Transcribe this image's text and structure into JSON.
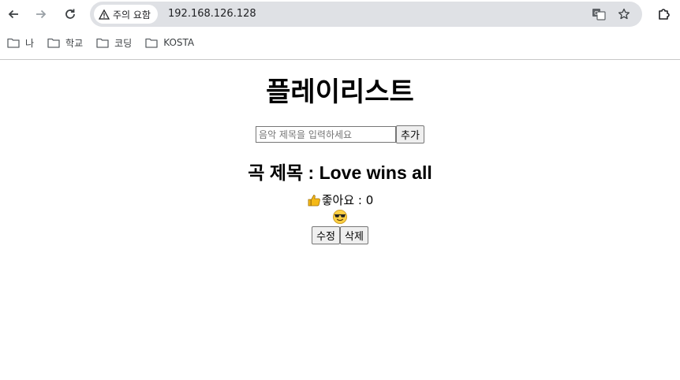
{
  "browser": {
    "security_label": "주의 요함",
    "url": "192.168.126.128",
    "icons": [
      "back-icon",
      "forward-icon",
      "reload-icon",
      "warning-icon",
      "translate-icon",
      "star-icon",
      "extensions-icon",
      "folder-icon",
      "thumbs-up-icon",
      "sunglasses-face-icon"
    ]
  },
  "bookmarks": [
    {
      "label": "나"
    },
    {
      "label": "학교"
    },
    {
      "label": "코딩"
    },
    {
      "label": "KOSTA"
    }
  ],
  "page": {
    "title": "플레이리스트",
    "input_placeholder": "음악 제목을 입력하세요",
    "add_button": "추가",
    "song_title": "곡 제목 : Love wins all",
    "likes_text": "좋아요 : 0",
    "edit_button": "수정",
    "delete_button": "삭제"
  }
}
